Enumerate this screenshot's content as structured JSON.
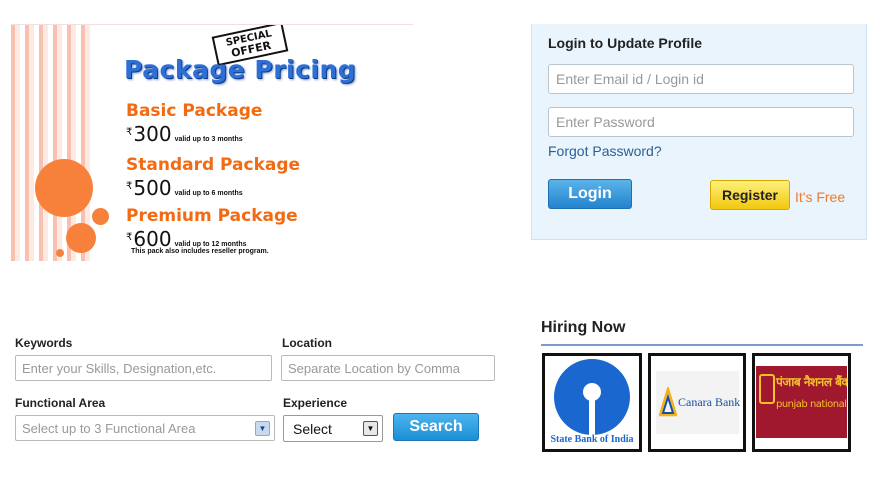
{
  "promo": {
    "badge_line1": "SPECIAL",
    "badge_line2": "OFFER",
    "title": "Package Pricing",
    "rupee_symbol": "₹",
    "packages": [
      {
        "name": "Basic Package",
        "price": "300",
        "validity": "valid up to 3 months"
      },
      {
        "name": "Standard Package",
        "price": "500",
        "validity": "valid up to 6 months"
      },
      {
        "name": "Premium Package",
        "price": "600",
        "validity": "valid up to 12 months"
      }
    ],
    "note": "This pack also includes reseller program."
  },
  "login": {
    "title": "Login to Update Profile",
    "email_placeholder": "Enter Email id / Login id",
    "password_placeholder": "Enter Password",
    "forgot_label": "Forgot Password?",
    "login_label": "Login",
    "register_label": "Register",
    "free_label": "It's Free"
  },
  "search": {
    "keywords_label": "Keywords",
    "keywords_placeholder": "Enter your Skills, Designation,etc.",
    "location_label": "Location",
    "location_placeholder": "Separate Location by Comma",
    "functional_label": "Functional Area",
    "functional_placeholder": "Select up to 3 Functional Area",
    "experience_label": "Experience",
    "experience_value": "Select",
    "search_label": "Search"
  },
  "hiring": {
    "title": "Hiring Now",
    "companies": [
      {
        "name": "State Bank of India",
        "logo_text": "State Bank of India"
      },
      {
        "name": "Canara Bank",
        "logo_text": "Canara Bank"
      },
      {
        "name": "Punjab National Bank",
        "logo_text_hindi": "पंजाब नैशनल बैंक",
        "logo_text": "punjab national bank"
      }
    ]
  },
  "colors": {
    "accent_orange": "#f26a12",
    "title_blue": "#2e6fd6",
    "login_bg": "#e9f4fd",
    "button_blue": "#2383cc",
    "register_yellow": "#f2c80f"
  },
  "icons": [
    "dropdown-arrow-icon",
    "sbi-logo",
    "canara-logo",
    "pnb-logo"
  ]
}
